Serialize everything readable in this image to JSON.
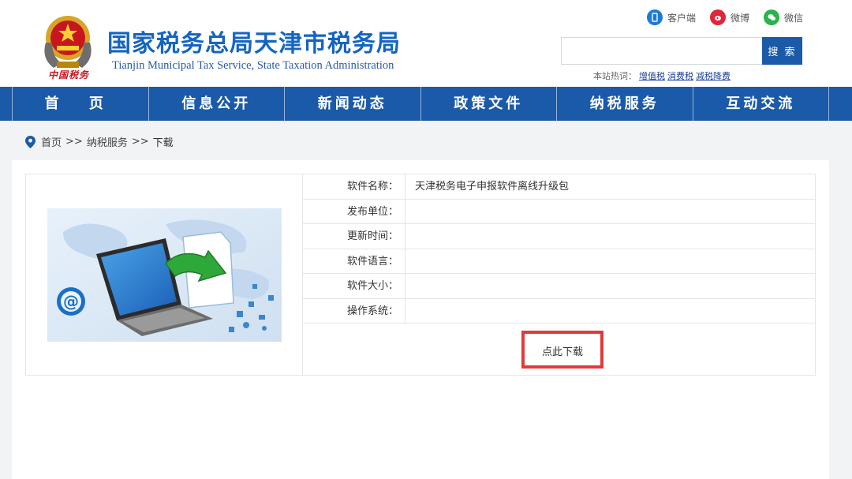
{
  "header": {
    "title": "国家税务总局天津市税务局",
    "subtitle": "Tianjin Municipal Tax Service, State Taxation Administration",
    "emblem_text": "中国税务",
    "top_links": [
      {
        "label": "客户端",
        "icon": "mobile-icon",
        "color": "#1a7bd8"
      },
      {
        "label": "微博",
        "icon": "weibo-icon",
        "color": "#e0263a"
      },
      {
        "label": "微信",
        "icon": "wechat-icon",
        "color": "#2bb24c"
      }
    ],
    "search": {
      "value": "",
      "placeholder": "",
      "button_label": "搜 索"
    },
    "hotwords": {
      "label": "本站热词：",
      "items": [
        "增值税",
        "消费税",
        "减税降费"
      ]
    }
  },
  "nav": {
    "items": [
      "首 页",
      "信息公开",
      "新闻动态",
      "政策文件",
      "纳税服务",
      "互动交流"
    ]
  },
  "breadcrumb": {
    "items": [
      "首页",
      "纳税服务",
      "下载"
    ],
    "separator": ">>"
  },
  "software": {
    "rows": [
      {
        "label": "软件名称：",
        "value": "天津税务电子申报软件离线升级包"
      },
      {
        "label": "发布单位：",
        "value": ""
      },
      {
        "label": "更新时间：",
        "value": ""
      },
      {
        "label": "软件语言：",
        "value": ""
      },
      {
        "label": "软件大小：",
        "value": ""
      },
      {
        "label": "操作系统：",
        "value": ""
      }
    ],
    "download_label": "点此下载"
  },
  "colors": {
    "brand_blue": "#1a5aa8",
    "title_blue": "#1565c0",
    "highlight_red": "#e23a3a"
  }
}
